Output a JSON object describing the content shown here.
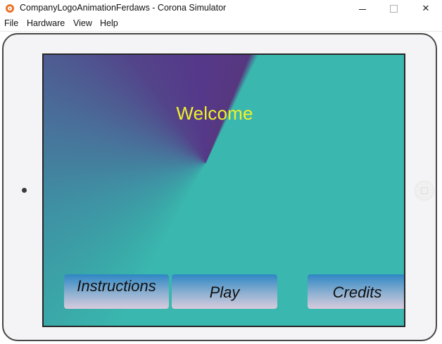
{
  "window": {
    "title": "CompanyLogoAnimationFerdaws - Corona Simulator",
    "controls": {
      "minimize_icon": "minimize-icon",
      "maximize_icon": "maximize-icon",
      "close_icon": "close-icon",
      "close_glyph": "✕"
    }
  },
  "menu": {
    "items": [
      {
        "label": "File"
      },
      {
        "label": "Hardware"
      },
      {
        "label": "View"
      },
      {
        "label": "Help"
      }
    ]
  },
  "app": {
    "welcome_text": "Welcome",
    "welcome_color": "#f3f028",
    "buttons": {
      "instructions": "Instructions",
      "play": "Play",
      "credits": "Credits"
    },
    "colors": {
      "teal": "#3ab7ae",
      "purple": "#55388a",
      "button_top": "#2e86c4",
      "button_bottom": "#d8cbdd"
    }
  }
}
